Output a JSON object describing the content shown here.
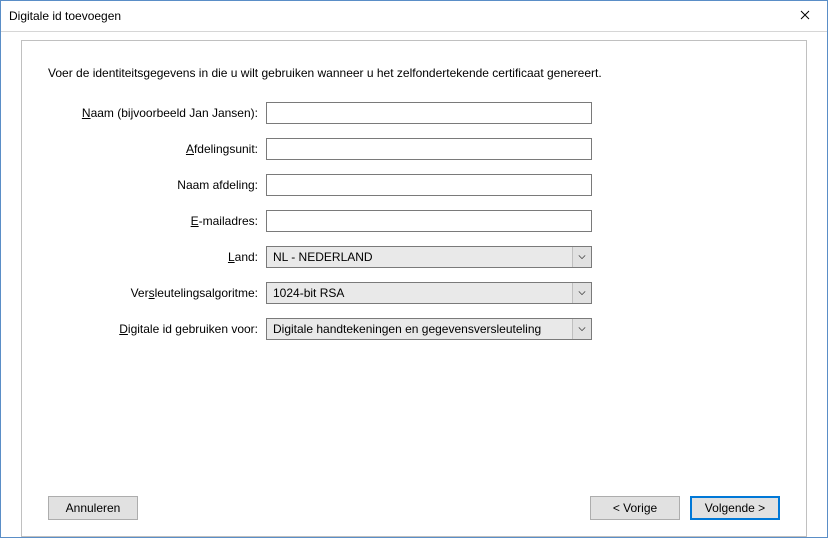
{
  "window": {
    "title": "Digitale id toevoegen"
  },
  "instructions": "Voer de identiteitsgegevens in die u wilt gebruiken wanneer u het zelfondertekende certificaat genereert.",
  "labels": {
    "name_pre": "N",
    "name_post": "aam (bijvoorbeeld Jan Jansen):",
    "unit_pre": "A",
    "unit_post": "fdelingsunit:",
    "dept": "Naam afdeling:",
    "email_pre": "E",
    "email_post": "-mailadres:",
    "country_pre": "L",
    "country_post": "and:",
    "algo_pre": "Ver",
    "algo_mn": "s",
    "algo_post": "leutelingsalgoritme:",
    "usage_pre": "D",
    "usage_post": "igitale id gebruiken voor:"
  },
  "values": {
    "name": "",
    "unit": "",
    "dept": "",
    "email": "",
    "country": "NL - NEDERLAND",
    "algo": "1024-bit RSA",
    "usage": "Digitale handtekeningen en gegevensversleuteling"
  },
  "buttons": {
    "cancel": "Annuleren",
    "back": "< Vorige",
    "next": "Volgende >"
  }
}
